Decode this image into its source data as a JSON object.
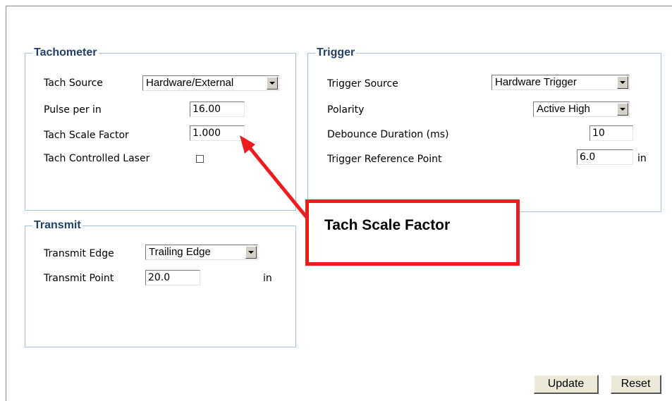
{
  "tachometer": {
    "legend": "Tachometer",
    "tach_source_label": "Tach Source",
    "tach_source_value": "Hardware/External",
    "pulse_label": "Pulse per in",
    "pulse_value": "16.00",
    "scale_label": "Tach Scale Factor",
    "scale_value": "1.000",
    "laser_label": "Tach Controlled Laser",
    "laser_checked": false
  },
  "trigger": {
    "legend": "Trigger",
    "source_label": "Trigger Source",
    "source_value": "Hardware Trigger",
    "polarity_label": "Polarity",
    "polarity_value": "Active High",
    "debounce_label": "Debounce Duration (ms)",
    "debounce_value": "10",
    "refpoint_label": "Trigger Reference Point",
    "refpoint_value": "6.0",
    "refpoint_unit": "in"
  },
  "transmit": {
    "legend": "Transmit",
    "edge_label": "Transmit Edge",
    "edge_value": "Trailing Edge",
    "point_label": "Transmit Point",
    "point_value": "20.0",
    "point_unit": "in"
  },
  "buttons": {
    "update": "Update",
    "reset": "Reset"
  },
  "callout": {
    "text": "Tach Scale Factor",
    "color": "#ee1c1c"
  }
}
